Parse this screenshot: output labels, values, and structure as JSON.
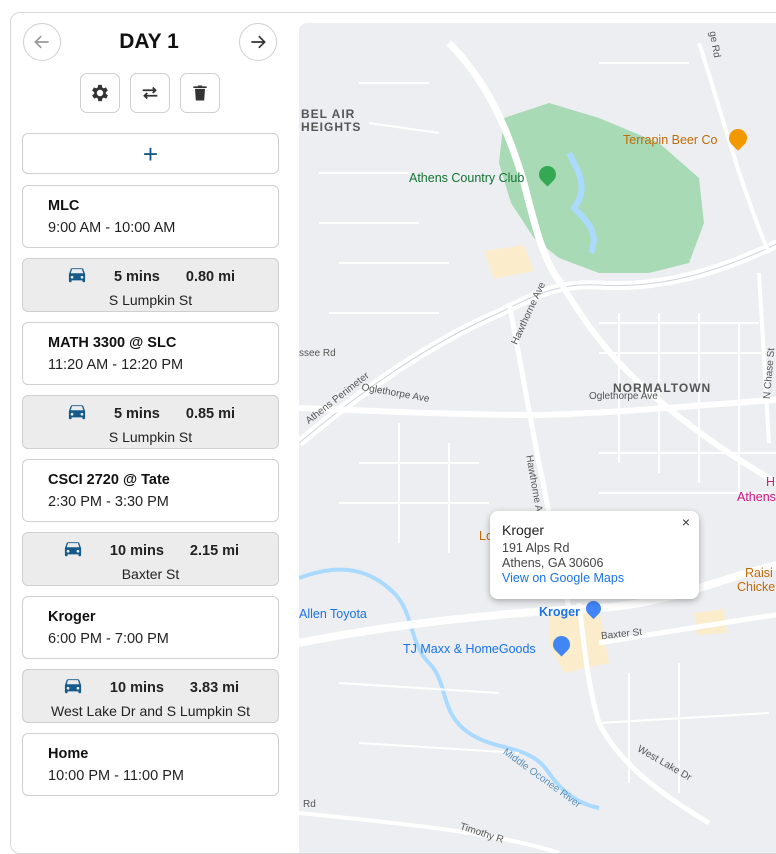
{
  "header": {
    "day_title": "DAY 1"
  },
  "toolbar": {
    "prev_icon": "arrow-left-icon",
    "next_icon": "arrow-right-icon",
    "settings_icon": "gear-icon",
    "swap_icon": "swap-arrows-icon",
    "delete_icon": "trash-icon",
    "add_label": "+"
  },
  "itinerary": [
    {
      "kind": "event",
      "name": "MLC",
      "time": "9:00 AM - 10:00 AM"
    },
    {
      "kind": "travel",
      "mins": "5 mins",
      "dist": "0.80 mi",
      "street": "S Lumpkin St"
    },
    {
      "kind": "event",
      "name": "MATH 3300 @ SLC",
      "time": "11:20 AM - 12:20 PM"
    },
    {
      "kind": "travel",
      "mins": "5 mins",
      "dist": "0.85 mi",
      "street": "S Lumpkin St"
    },
    {
      "kind": "event",
      "name": "CSCI 2720 @ Tate",
      "time": "2:30 PM - 3:30 PM"
    },
    {
      "kind": "travel",
      "mins": "10 mins",
      "dist": "2.15 mi",
      "street": "Baxter St"
    },
    {
      "kind": "event",
      "name": "Kroger",
      "time": "6:00 PM - 7:00 PM"
    },
    {
      "kind": "travel",
      "mins": "10 mins",
      "dist": "3.83 mi",
      "street": "West Lake Dr and S Lumpkin St"
    },
    {
      "kind": "event",
      "name": "Home",
      "time": "10:00 PM - 11:00 PM"
    }
  ],
  "map": {
    "places": {
      "bel_air_1": "BEL AIR",
      "bel_air_2": "HEIGHTS",
      "terrapin": "Terrapin Beer Co",
      "country_club": "Athens Country Club",
      "normaltown": "NORMALTOWN",
      "allen_toyota": "Allen Toyota",
      "tj_maxx": "TJ Maxx & HomeGoods",
      "kroger": "Kroger",
      "athens_partial_1": "H",
      "athens_partial_2": "Athens",
      "raising_1": "Raisi",
      "raising_2": "Chicke",
      "lo_partial": "Lo"
    },
    "roads": {
      "hawthorne_ave_1": "Hawthorne Ave",
      "hawthorne_ave_2": "Hawthorne A",
      "oglethorpe_1": "Oglethorpe Ave",
      "oglethorpe_2": "Oglethorpe Ave",
      "athens_perimeter": "Athens Perimeter",
      "baxter": "Baxter St",
      "west_lake": "West Lake Dr",
      "middle_oconee": "Middle Oconee River",
      "n_chase": "N Chase St",
      "timothy": "Timothy R",
      "ssee_rd": "ssee Rd",
      "rd_left": "Rd",
      "ge_rd": "ge Rd"
    },
    "info_window": {
      "title": "Kroger",
      "address_line1": "191 Alps Rd",
      "address_line2": "Athens, GA 30606",
      "link": "View on Google Maps",
      "close": "×"
    },
    "colors": {
      "park": "#a8dab5",
      "water": "#aadaff",
      "road": "#ffffff",
      "land": "#eceef1",
      "accent": "#155a8a"
    }
  }
}
